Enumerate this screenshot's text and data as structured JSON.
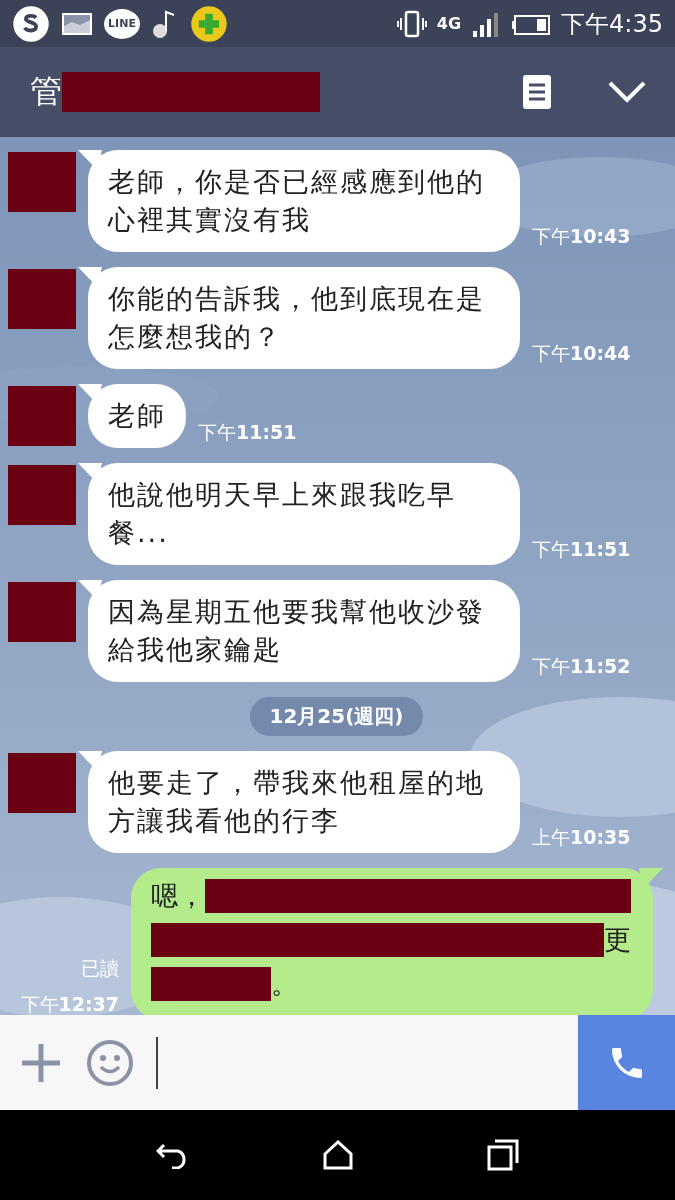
{
  "status_bar": {
    "notifications": [
      {
        "kind": "skype"
      },
      {
        "kind": "gallery"
      },
      {
        "kind": "line",
        "label": "LINE"
      },
      {
        "kind": "music"
      },
      {
        "kind": "plus"
      }
    ],
    "network": "4G",
    "time": "下午4:35"
  },
  "header": {
    "title": "管",
    "title_redacted": true
  },
  "messages": [
    {
      "kind": "incoming",
      "avatar_redacted": true,
      "text": "老師，你是否已經感應到他的心裡其實沒有我",
      "time": "下午**10:43**"
    },
    {
      "kind": "incoming",
      "avatar_redacted": true,
      "text": "你能的告訴我，他到底現在是怎麼想我的？",
      "time": "下午**10:44**"
    },
    {
      "kind": "incoming",
      "avatar_redacted": true,
      "text": "老師",
      "time": "下午**11:51**"
    },
    {
      "kind": "incoming",
      "avatar_redacted": true,
      "text": "他說他明天早上來跟我吃早餐...",
      "time": "下午**11:51**"
    },
    {
      "kind": "incoming",
      "avatar_redacted": true,
      "text": "因為星期五他要我幫他收沙發給我他家鑰匙",
      "time": "下午**11:52**"
    },
    {
      "kind": "date",
      "text": "12月25(週四)"
    },
    {
      "kind": "incoming",
      "avatar_redacted": true,
      "text": "他要走了，帶我來他租屋的地方讓我看他的行李",
      "time": "上午**10:35**"
    },
    {
      "kind": "outgoing",
      "read": "已讀",
      "time": "下午**12:37**",
      "lines": [
        [
          {
            "kind": "text",
            "text": "嗯，"
          },
          {
            "kind": "redacted"
          }
        ],
        [
          {
            "kind": "redacted"
          },
          {
            "kind": "text",
            "text": "更"
          }
        ],
        [
          {
            "kind": "redacted_short"
          },
          {
            "kind": "text",
            "text": "。"
          }
        ]
      ]
    }
  ]
}
